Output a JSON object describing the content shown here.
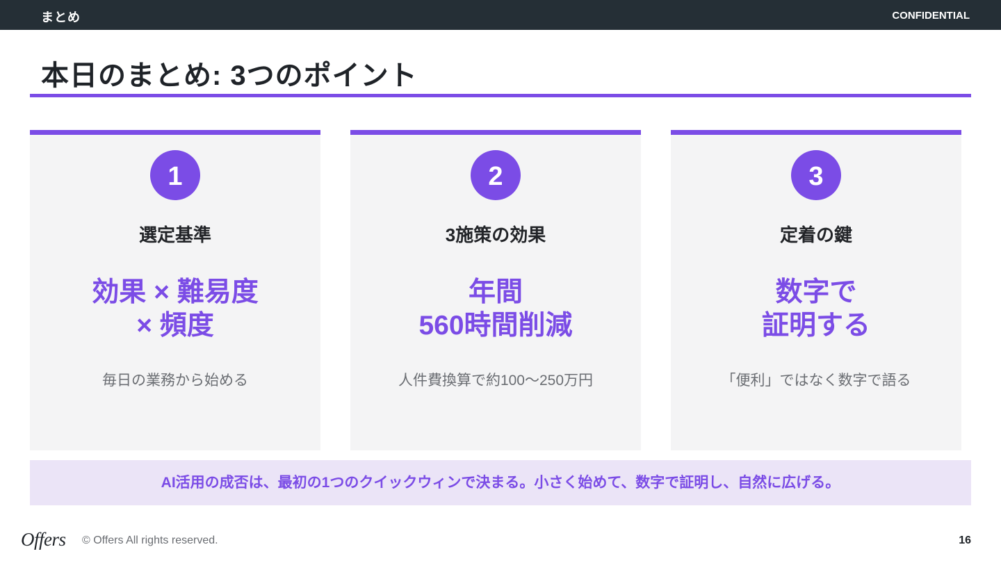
{
  "header": {
    "section": "まとめ",
    "confidential": "CONFIDENTIAL"
  },
  "title": "本日のまとめ: 3つのポイント",
  "cards": [
    {
      "number": "1",
      "heading": "選定基準",
      "big_lines": [
        "効果 × 難易度",
        "× 頻度"
      ],
      "sub": "毎日の業務から始める"
    },
    {
      "number": "2",
      "heading": "3施策の効果",
      "big_lines": [
        "年間",
        "560時間削減"
      ],
      "sub": "人件費換算で約100〜250万円"
    },
    {
      "number": "3",
      "heading": "定着の鍵",
      "big_lines": [
        "数字で",
        "証明する"
      ],
      "sub": "「便利」ではなく数字で語る"
    }
  ],
  "summary": "AI活用の成否は、最初の1つのクイックウィンで決まる。小さく始めて、数字で証明し、自然に広げる。",
  "footer": {
    "logo": "Offers",
    "copyright": "© Offers All rights reserved.",
    "page_number": "16"
  },
  "colors": {
    "accent": "#7b4ce6",
    "topbar": "#252f36",
    "card_bg": "#f4f4f5",
    "summary_bg": "#ebe4f7"
  }
}
